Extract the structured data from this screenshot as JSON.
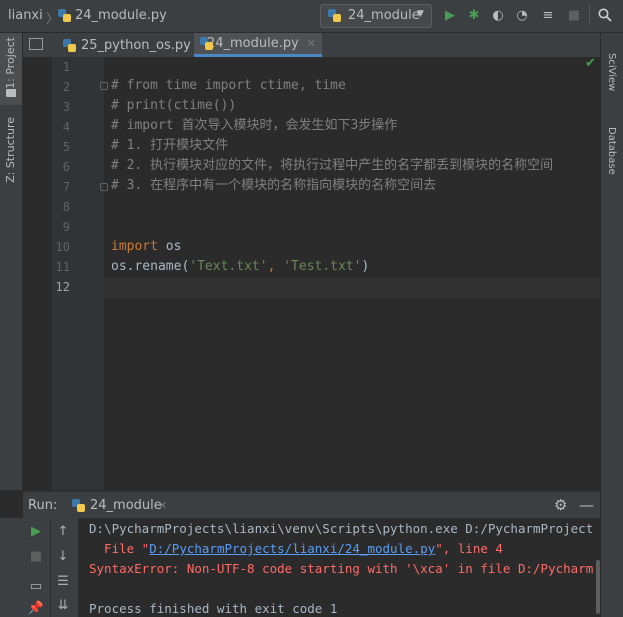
{
  "breadcrumb": {
    "project": "lianxi",
    "file": "24_module.py"
  },
  "toolbar": {
    "run_config": "24_module"
  },
  "left_strip": {
    "project": "1: Project",
    "structure": "Z: Structure"
  },
  "right_strip": {
    "sciview": "SciView",
    "database": "Database"
  },
  "tabs": [
    {
      "label": "25_python_os.py",
      "active": false
    },
    {
      "label": "24_module.py",
      "active": true
    }
  ],
  "editor": {
    "line_numbers": [
      "1",
      "2",
      "3",
      "4",
      "5",
      "6",
      "7",
      "8",
      "9",
      "10",
      "11",
      "12"
    ],
    "lines": {
      "l2": "# from time import ctime, time",
      "l3": "# print(ctime())",
      "l4": "# import 首次导入模块时，会发生如下3步操作",
      "l5": "# 1. 打开模块文件",
      "l6": "# 2. 执行模块对应的文件，将执行过程中产生的名字都丢到模块的名称空间",
      "l7": "# 3. 在程序中有一个模块的名称指向模块的名称空间去",
      "l10_kw": "import",
      "l10_rest": " os",
      "l11_a": "os.rename(",
      "l11_s1": "'Text.txt'",
      "l11_b": ", ",
      "l11_s2": "'Test.txt'",
      "l11_c": ")"
    }
  },
  "run": {
    "label": "Run:",
    "tab": "24_module",
    "console": {
      "cmd": "D:\\PycharmProjects\\lianxi\\venv\\Scripts\\python.exe D:/PycharmProject",
      "file_pre": "  File \"",
      "file_link": "D:/PycharmProjects/lianxi/24_module.py",
      "file_post": "\", line 4",
      "error": "SyntaxError: Non-UTF-8 code starting with '\\xca' in file D:/Pycharm",
      "exit": "Process finished with exit code 1"
    }
  },
  "colors": {
    "accent": "#4a88c7",
    "run_green": "#499c54",
    "error": "#ff6b68"
  }
}
